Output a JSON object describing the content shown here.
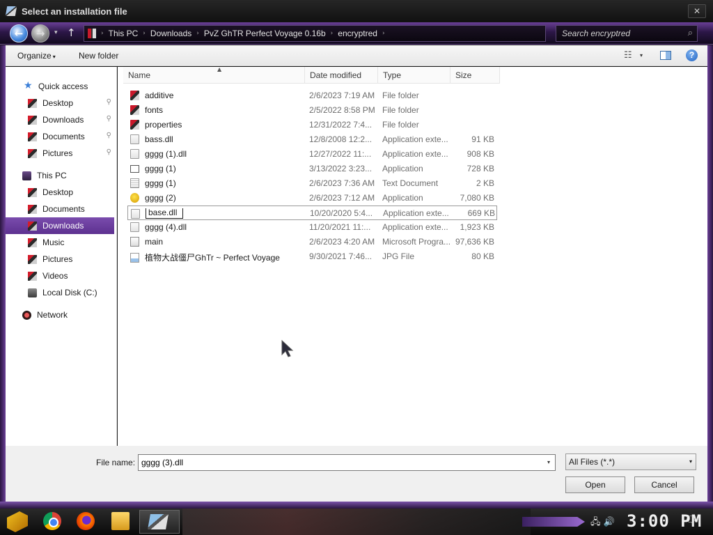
{
  "window": {
    "title": "Select an installation file",
    "close_glyph": "✕"
  },
  "nav": {
    "back_glyph": "←",
    "forward_glyph": "→",
    "dropdown_glyph": "▾",
    "up_glyph": "↑",
    "breadcrumbs": [
      "This PC",
      "Downloads",
      "PvZ GhTR Perfect Voyage 0.16b",
      "encryptred"
    ],
    "separator": "›",
    "search_placeholder": "Search encryptred"
  },
  "toolbar": {
    "organize_label": "Organize",
    "new_folder_label": "New folder",
    "caret": "▾",
    "view_glyph": "☷"
  },
  "navpane": {
    "items": [
      {
        "label": "Quick access",
        "icon": "star-icon",
        "pinned": false,
        "selected": false
      },
      {
        "label": "Desktop",
        "icon": "folder-icon",
        "pinned": true,
        "selected": false
      },
      {
        "label": "Downloads",
        "icon": "folder-icon",
        "pinned": true,
        "selected": false
      },
      {
        "label": "Documents",
        "icon": "folder-icon",
        "pinned": true,
        "selected": false
      },
      {
        "label": "Pictures",
        "icon": "folder-icon",
        "pinned": true,
        "selected": false
      },
      {
        "label": "This PC",
        "icon": "computer-icon",
        "pinned": false,
        "selected": false
      },
      {
        "label": "Desktop",
        "icon": "folder-icon",
        "pinned": false,
        "selected": false
      },
      {
        "label": "Documents",
        "icon": "folder-icon",
        "pinned": false,
        "selected": false
      },
      {
        "label": "Downloads",
        "icon": "folder-icon",
        "pinned": false,
        "selected": true
      },
      {
        "label": "Music",
        "icon": "folder-icon",
        "pinned": false,
        "selected": false
      },
      {
        "label": "Pictures",
        "icon": "folder-icon",
        "pinned": false,
        "selected": false
      },
      {
        "label": "Videos",
        "icon": "folder-icon",
        "pinned": false,
        "selected": false
      },
      {
        "label": "Local Disk (C:)",
        "icon": "disk-icon",
        "pinned": false,
        "selected": false
      },
      {
        "label": "Network",
        "icon": "network-icon",
        "pinned": false,
        "selected": false
      }
    ],
    "pin_glyph": "📌"
  },
  "columns": {
    "name": "Name",
    "date": "Date modified",
    "type": "Type",
    "size": "Size",
    "sort_glyph": "▲"
  },
  "files": [
    {
      "name": "additive",
      "date": "2/6/2023 7:19 AM",
      "type": "File folder",
      "size": "",
      "icon": "folder"
    },
    {
      "name": "fonts",
      "date": "2/5/2022 8:58 PM",
      "type": "File folder",
      "size": "",
      "icon": "folder"
    },
    {
      "name": "properties",
      "date": "12/31/2022 7:4...",
      "type": "File folder",
      "size": "",
      "icon": "folder"
    },
    {
      "name": "bass.dll",
      "date": "12/8/2008 12:2...",
      "type": "Application exte...",
      "size": "91 KB",
      "icon": "dll"
    },
    {
      "name": "gggg (1).dll",
      "date": "12/27/2022 11:...",
      "type": "Application exte...",
      "size": "908 KB",
      "icon": "dll"
    },
    {
      "name": "gggg (1)",
      "date": "3/13/2022 3:23...",
      "type": "Application",
      "size": "728 KB",
      "icon": "app"
    },
    {
      "name": "gggg (1)",
      "date": "2/6/2023 7:36 AM",
      "type": "Text Document",
      "size": "2 KB",
      "icon": "txt"
    },
    {
      "name": "gggg (2)",
      "date": "2/6/2023 7:12 AM",
      "type": "Application",
      "size": "7,080 KB",
      "icon": "duck"
    },
    {
      "name": "base.dll",
      "date": "10/20/2020 5:4...",
      "type": "Application exte...",
      "size": "669 KB",
      "icon": "dll",
      "renaming": true
    },
    {
      "name": "gggg (4).dll",
      "date": "11/20/2021 11:...",
      "type": "Application exte...",
      "size": "1,923 KB",
      "icon": "dll"
    },
    {
      "name": "main",
      "date": "2/6/2023 4:20 AM",
      "type": "Microsoft Progra...",
      "size": "97,636 KB",
      "icon": "exe"
    },
    {
      "name": "植物大战僵尸GhTr ~ Perfect Voyage",
      "date": "9/30/2021 7:46...",
      "type": "JPG File",
      "size": "80 KB",
      "icon": "jpg"
    }
  ],
  "footer": {
    "file_name_label": "File name:",
    "file_name_value": "gggg (3).dll",
    "filter_value": "All Files (*.*)",
    "open_label": "Open",
    "cancel_label": "Cancel"
  },
  "taskbar": {
    "clock": "3:00 PM",
    "tray_glyphs": "🖧 🔊",
    "notif_glyph": "🗨"
  },
  "colors": {
    "accent_purple": "#6a3f96",
    "selected_nav": "#6b3ea0"
  }
}
